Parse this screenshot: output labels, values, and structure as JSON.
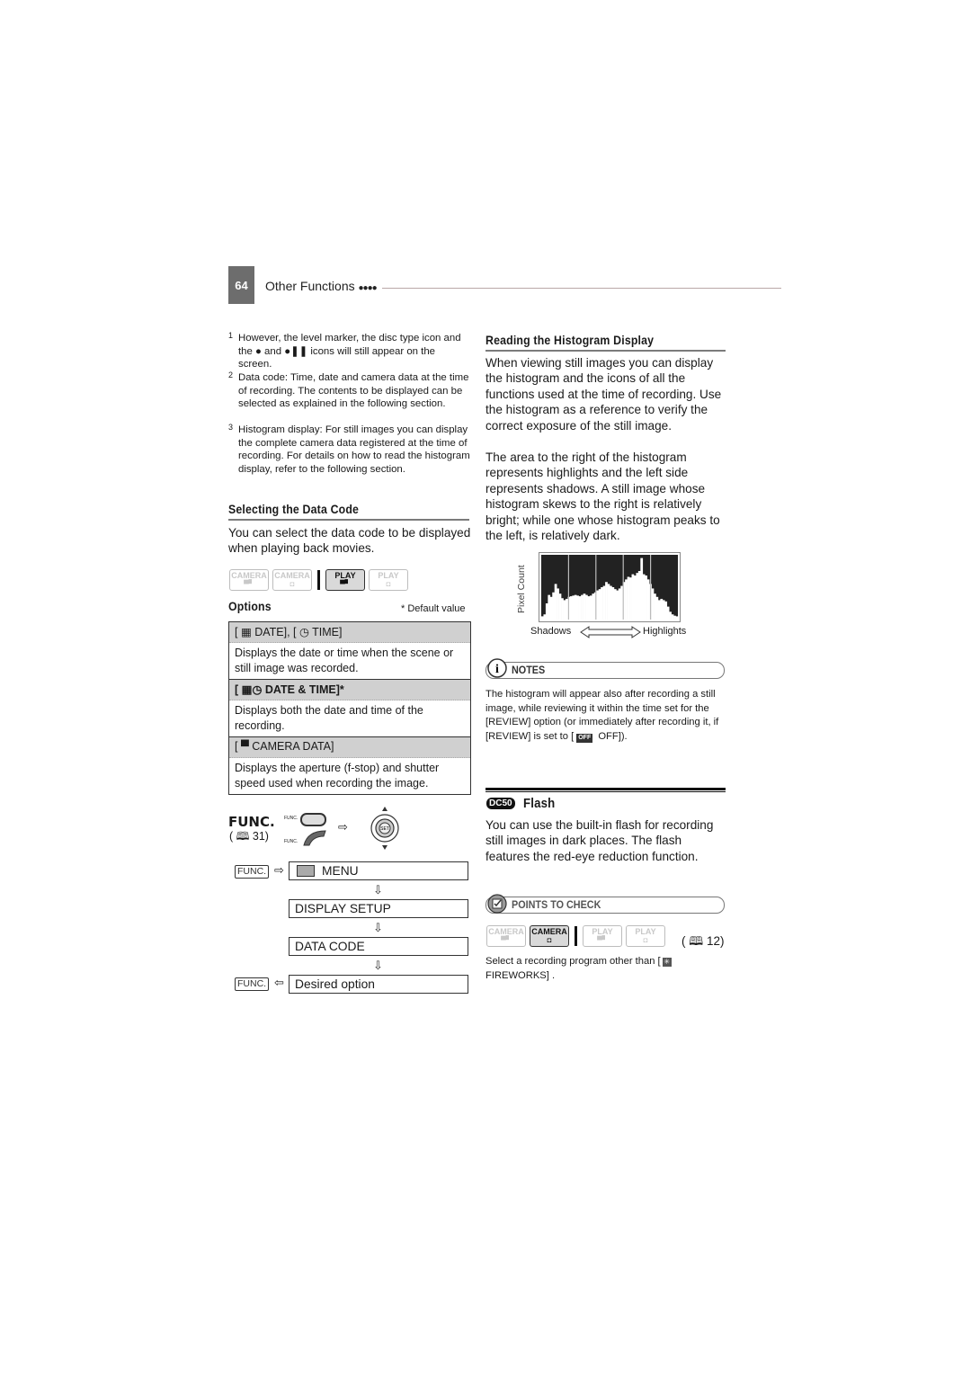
{
  "header": {
    "page_number": "64",
    "chapter": "Other Functions",
    "chapter_dots": "●●●●"
  },
  "footnotes": [
    {
      "num": "1",
      "text": "However, the level marker, the disc type icon and the ● and ●❚❚ icons will still appear on the screen."
    },
    {
      "num": "2",
      "text": "Data code: Time, date and camera data at the time of recording. The contents to be displayed can be selected as explained in the following section."
    },
    {
      "num": "3",
      "text": "Histogram display: For still images you can display the complete camera data registered at the time of recording. For details on how to read the histogram display, refer to the following section."
    }
  ],
  "data_code_section": {
    "title": "Selecting the Data Code",
    "body": "You can select the data code to be displayed when playing back movies.",
    "modes": [
      {
        "label": "CAMERA",
        "sub_icon": "movie-icon",
        "active": false
      },
      {
        "label": "CAMERA",
        "sub_icon": "still-camera-icon",
        "active": false
      },
      {
        "label": "PLAY",
        "sub_icon": "movie-icon",
        "active": true
      },
      {
        "label": "PLAY",
        "sub_icon": "still-camera-icon",
        "active": false
      }
    ],
    "options_title": "Options",
    "default_note": "* Default value",
    "options": [
      {
        "name": "[ ▦ DATE], [ ◷ TIME]",
        "desc": "Displays the date or time when the scene or still image was recorded.",
        "bold": false
      },
      {
        "name": "[ ▦◷ DATE & TIME]*",
        "desc": "Displays both the date and time of the recording.",
        "bold": true
      },
      {
        "name": "[ ▀ CAMERA DATA]",
        "desc": "Displays the aperture (f-stop) and shutter speed used when recording the image.",
        "bold": false
      }
    ]
  },
  "func_flow": {
    "func_label": "FUNC.",
    "page_ref": "31",
    "func_small": "FUNC.",
    "set_label": "SET",
    "func_key": "FUNC.",
    "steps": [
      "MENU",
      "DISPLAY SETUP",
      "DATA CODE",
      "Desired option"
    ]
  },
  "histogram_section": {
    "title": "Reading the Histogram Display",
    "para1": "When viewing still images you can display the histogram and the icons of all the functions used at the time of recording. Use the histogram as a reference to verify the correct exposure of the still image.",
    "para2": "The area to the right of the histogram represents highlights and the left side represents shadows. A still image whose histogram skews to the right is relatively bright; while one whose histogram peaks to the left, is relatively dark.",
    "figure": {
      "ylabel": "Pixel Count",
      "left_label": "Shadows",
      "right_label": "Highlights",
      "profile": [
        0.05,
        0.08,
        0.25,
        0.38,
        0.35,
        0.42,
        0.55,
        0.48,
        0.4,
        0.33,
        0.3,
        0.32,
        0.35,
        0.36,
        0.37,
        0.38,
        0.37,
        0.36,
        0.38,
        0.4,
        0.38,
        0.36,
        0.37,
        0.4,
        0.42,
        0.45,
        0.47,
        0.5,
        0.52,
        0.58,
        0.55,
        0.52,
        0.5,
        0.47,
        0.45,
        0.48,
        0.52,
        0.58,
        0.62,
        0.66,
        0.65,
        0.7,
        0.68,
        0.72,
        0.75,
        0.95,
        0.7,
        0.68,
        0.62,
        0.55,
        0.48,
        0.4,
        0.35,
        0.3,
        0.32,
        0.3,
        0.28,
        0.2,
        0.12,
        0.08,
        0.06,
        0.05
      ]
    }
  },
  "notes": {
    "label": "NOTES",
    "text": "The histogram will appear also after recording a still image, while reviewing it within the time set for the [REVIEW] option (or immediately after recording it, if [REVIEW] is set to [",
    "off_badge": "OFF",
    "text_end": " OFF])."
  },
  "flash_section": {
    "badge": "DC50",
    "title": "Flash",
    "body": "You can use the built-in flash for recording still images in dark places. The flash features the red-eye reduction function."
  },
  "points_to_check": {
    "label": "POINTS TO CHECK",
    "modes": [
      {
        "label": "CAMERA",
        "sub_icon": "movie-icon",
        "active": false
      },
      {
        "label": "CAMERA",
        "sub_icon": "still-camera-icon",
        "active": true
      },
      {
        "label": "PLAY",
        "sub_icon": "movie-icon",
        "active": false
      },
      {
        "label": "PLAY",
        "sub_icon": "still-camera-icon",
        "active": false
      }
    ],
    "page_ref": "12",
    "text": "Select a recording program other than [",
    "text_end": " FIREWORKS] ."
  }
}
